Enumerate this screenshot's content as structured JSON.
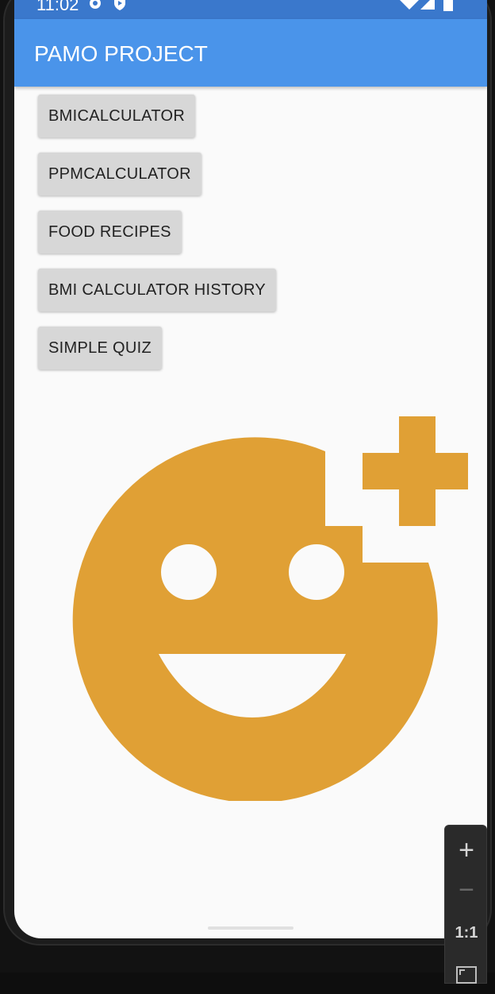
{
  "status_bar": {
    "time": "11:02",
    "icons": [
      "gear-icon",
      "shield-icon",
      "wifi-icon",
      "signal-icon",
      "battery-icon"
    ]
  },
  "app_bar": {
    "title": "PAMO PROJECT",
    "color": "#4a94ea"
  },
  "menu": {
    "buttons": [
      {
        "label": "BMICALCULATOR"
      },
      {
        "label": "PPMCALCULATOR"
      },
      {
        "label": "FOOD RECIPES"
      },
      {
        "label": "BMI CALCULATOR HISTORY"
      },
      {
        "label": "SIMPLE QUIZ"
      }
    ]
  },
  "logo": {
    "icon": "smiley-add-icon",
    "color": "#e0a035"
  },
  "zoom_toolbar": {
    "zoom_in": "+",
    "zoom_out": "−",
    "actual_size": "1:1"
  }
}
